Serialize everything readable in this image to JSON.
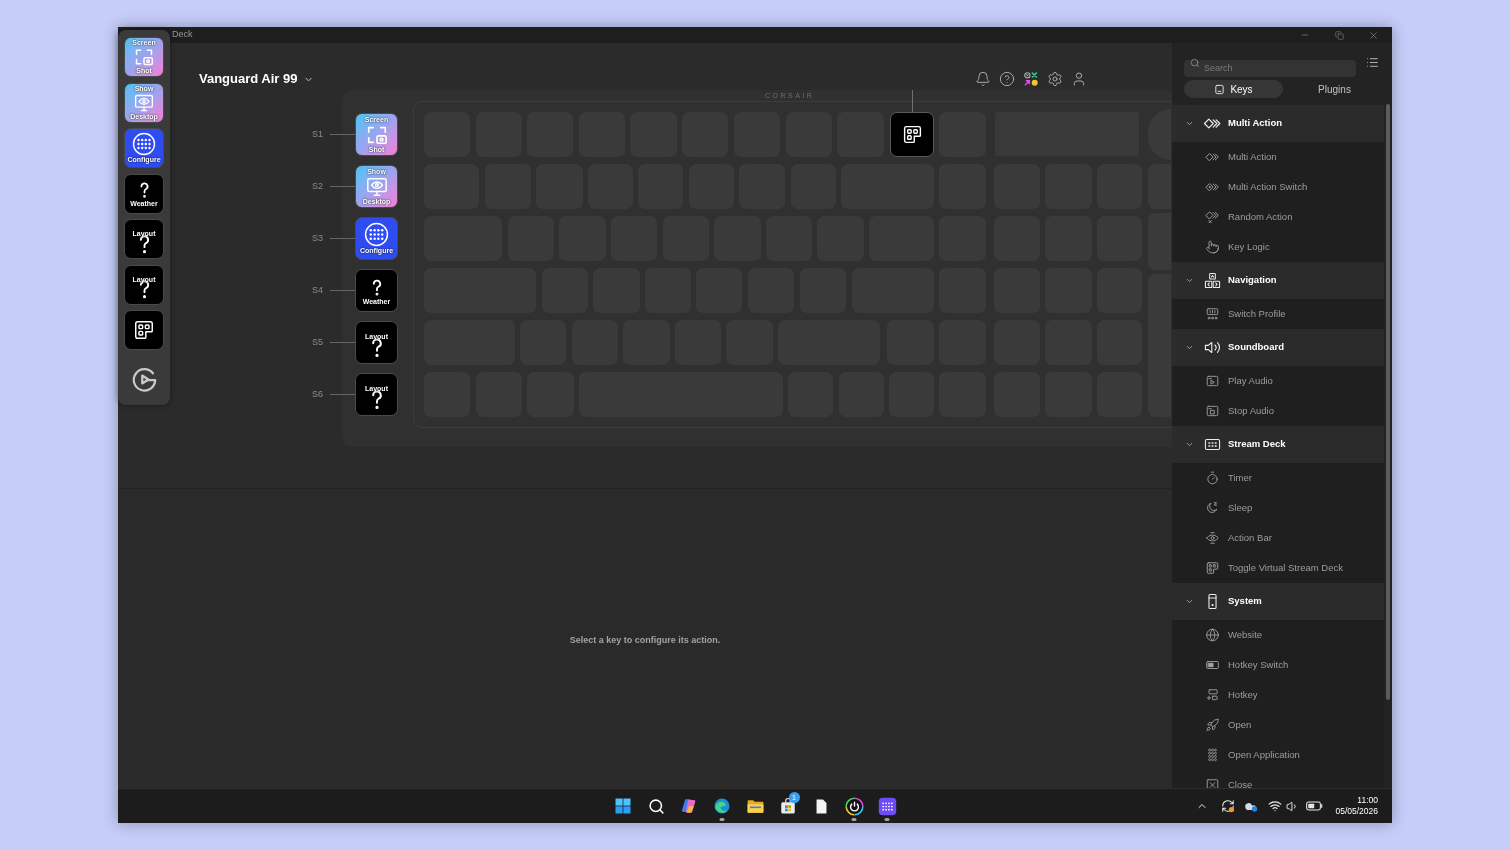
{
  "window": {
    "title": "Deck"
  },
  "dock": {
    "tiles": [
      {
        "kind": "screenshot",
        "top": "Screen",
        "bottom": "Shot"
      },
      {
        "kind": "desktop",
        "top": "Show",
        "bottom": "Desktop"
      },
      {
        "kind": "configure",
        "bottom": "Configure"
      },
      {
        "kind": "weather",
        "bottom": "Weather"
      },
      {
        "kind": "layout",
        "middle": "Layout"
      },
      {
        "kind": "layout",
        "middle": "Layout"
      },
      {
        "kind": "deck"
      }
    ]
  },
  "device": {
    "name": "Vanguard Air 99"
  },
  "keyboard": {
    "logo": "CORSAIR",
    "side_keys": [
      {
        "label": "S1",
        "tile": {
          "kind": "screenshot",
          "top": "Screen",
          "bottom": "Shot"
        }
      },
      {
        "label": "S2",
        "tile": {
          "kind": "desktop",
          "top": "Show",
          "bottom": "Desktop"
        }
      },
      {
        "label": "S3",
        "tile": {
          "kind": "configure",
          "bottom": "Configure"
        }
      },
      {
        "label": "S4",
        "tile": {
          "kind": "weather",
          "bottom": "Weather"
        }
      },
      {
        "label": "S5",
        "tile": {
          "kind": "layout",
          "middle": "Layout"
        }
      },
      {
        "label": "S6",
        "tile": {
          "kind": "layout",
          "middle": "Layout"
        }
      }
    ],
    "rows": [
      [
        {
          "assigned": false
        },
        {
          "assigned": false
        },
        {
          "assigned": false
        },
        {
          "assigned": false
        },
        {
          "assigned": false
        },
        {
          "assigned": false
        },
        {
          "assigned": false
        },
        {
          "assigned": false
        },
        {
          "assigned": false
        },
        {
          "assigned": true
        },
        {
          "assigned": false
        }
      ],
      [
        {
          "assigned": false
        },
        {
          "assigned": false
        },
        {
          "assigned": false
        },
        {
          "assigned": false
        },
        {
          "assigned": false
        },
        {
          "assigned": false
        },
        {
          "assigned": false
        },
        {
          "assigned": false
        },
        {
          "assigned": false
        },
        {
          "assigned": false
        },
        {
          "assigned": false
        },
        {
          "assigned": false
        },
        {
          "assigned": false
        }
      ],
      [
        {
          "assigned": false
        },
        {
          "assigned": false
        },
        {
          "assigned": false
        },
        {
          "assigned": false
        },
        {
          "assigned": false
        },
        {
          "assigned": false
        },
        {
          "assigned": false
        },
        {
          "assigned": false
        },
        {
          "assigned": false
        },
        {
          "assigned": false
        },
        {
          "assigned": false
        },
        {
          "assigned": false
        },
        {
          "assigned": false
        }
      ],
      [
        {
          "assigned": false
        },
        {
          "assigned": false
        },
        {
          "assigned": false
        },
        {
          "assigned": false
        },
        {
          "assigned": false
        },
        {
          "assigned": false
        },
        {
          "assigned": false
        },
        {
          "assigned": false
        },
        {
          "assigned": false
        },
        {
          "assigned": false
        },
        {
          "assigned": false
        },
        {
          "assigned": false
        }
      ],
      [
        {
          "assigned": false
        },
        {
          "assigned": false
        },
        {
          "assigned": false
        },
        {
          "assigned": false
        },
        {
          "assigned": false
        },
        {
          "assigned": false
        },
        {
          "assigned": false
        },
        {
          "assigned": false
        },
        {
          "assigned": false
        },
        {
          "assigned": false
        },
        {
          "assigned": false
        },
        {
          "assigned": false
        }
      ],
      [
        {
          "assigned": false
        },
        {
          "assigned": false
        },
        {
          "assigned": false
        },
        {
          "assigned": false
        },
        {
          "assigned": false
        },
        {
          "assigned": false
        },
        {
          "assigned": false
        },
        {
          "assigned": false
        },
        {
          "assigned": false
        },
        {
          "assigned": false
        },
        {
          "assigned": false
        }
      ]
    ]
  },
  "hint": "Select a key to configure its action.",
  "sidebar": {
    "search": {
      "placeholder": "Search"
    },
    "tabs": [
      {
        "label": "Keys",
        "selected": true
      },
      {
        "label": "Plugins",
        "selected": false
      }
    ],
    "groups": [
      {
        "label": "Multi Action",
        "expanded": true,
        "items": [
          "Multi Action",
          "Multi Action Switch",
          "Random Action",
          "Key Logic"
        ]
      },
      {
        "label": "Navigation",
        "expanded": true,
        "items": [
          "Switch Profile"
        ]
      },
      {
        "label": "Soundboard",
        "expanded": true,
        "items": [
          "Play Audio",
          "Stop Audio"
        ]
      },
      {
        "label": "Stream Deck",
        "expanded": true,
        "items": [
          "Timer",
          "Sleep",
          "Action Bar",
          "Toggle Virtual Stream Deck"
        ]
      },
      {
        "label": "System",
        "expanded": true,
        "items": [
          "Website",
          "Hotkey Switch",
          "Hotkey",
          "Open",
          "Open Application",
          "Close"
        ]
      }
    ]
  },
  "taskbar": {
    "apps": [
      {
        "running": false
      },
      {
        "running": false
      },
      {
        "running": false
      },
      {
        "running": true
      },
      {
        "running": false
      },
      {
        "running": false,
        "badge": "1"
      },
      {
        "running": false
      },
      {
        "running": true
      },
      {
        "running": true
      }
    ],
    "time": "11:00",
    "date": "05/05/2026"
  }
}
